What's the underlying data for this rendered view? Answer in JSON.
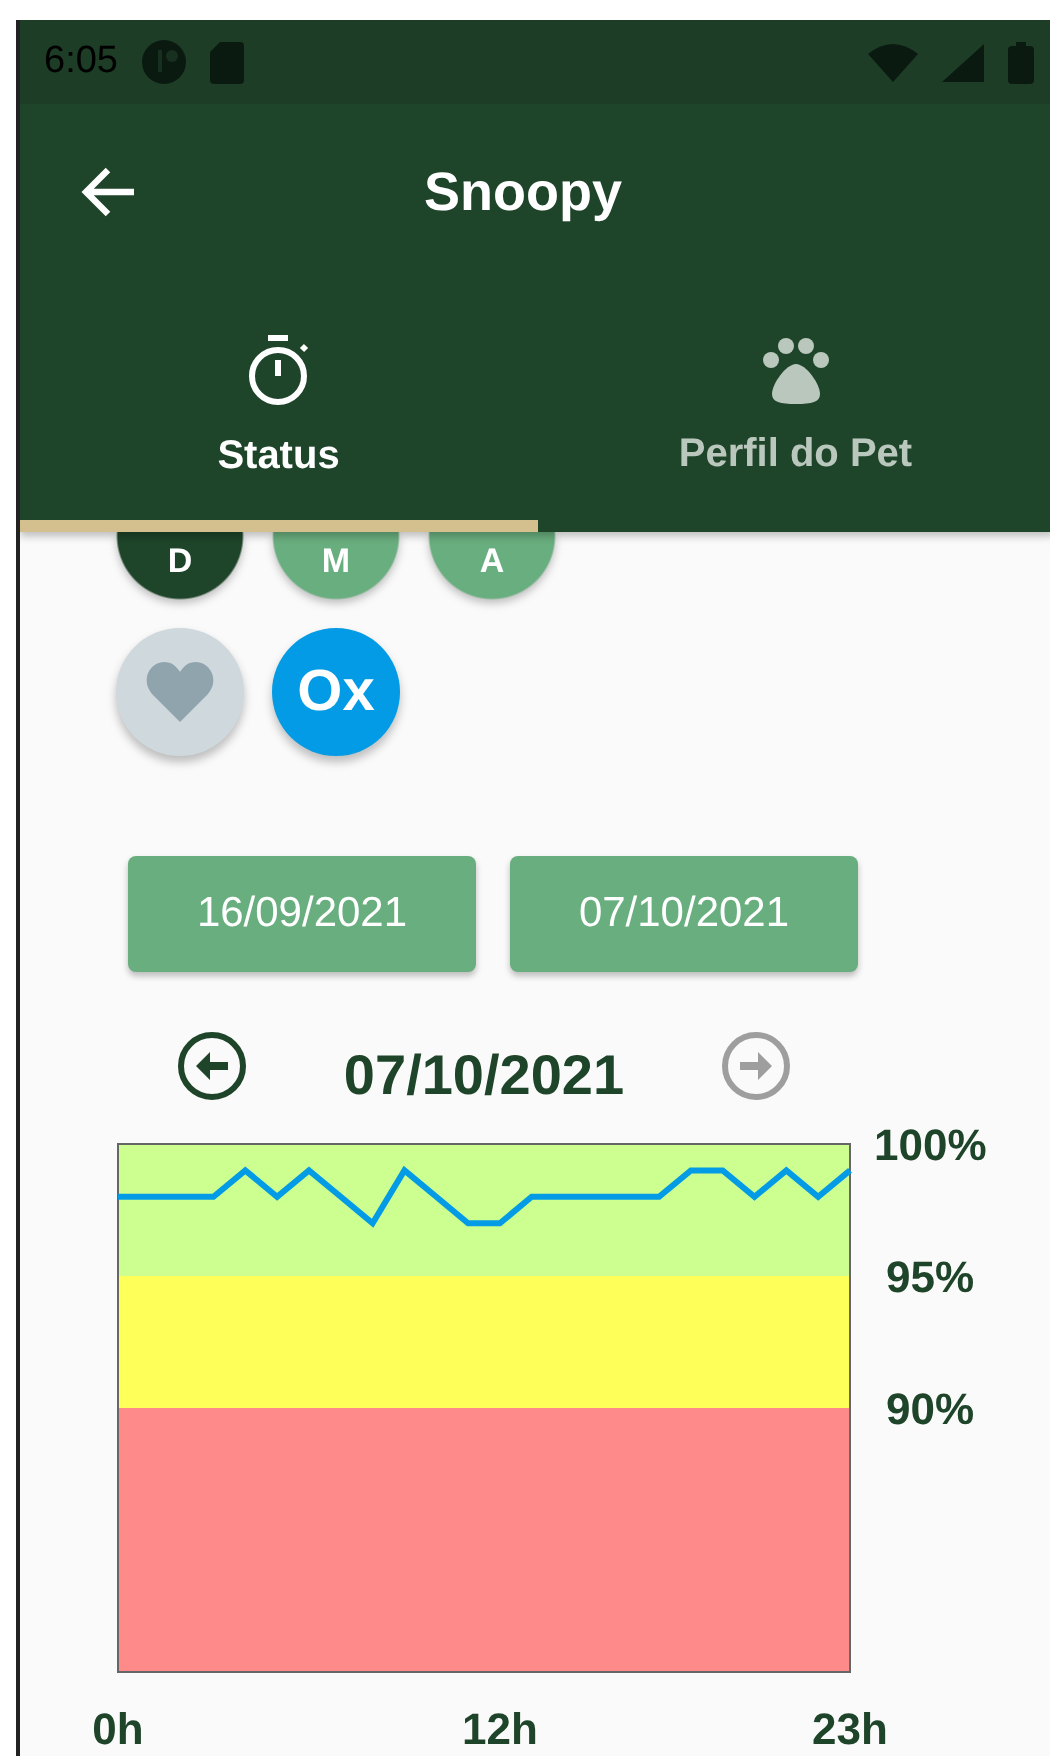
{
  "status_bar": {
    "time": "6:05"
  },
  "app_bar": {
    "title": "Snoopy"
  },
  "tabs": [
    {
      "label": "Status",
      "selected": true
    },
    {
      "label": "Perfil do Pet",
      "selected": false
    }
  ],
  "period_buttons": [
    {
      "label": "D",
      "selected": true
    },
    {
      "label": "M",
      "selected": false
    },
    {
      "label": "A",
      "selected": false
    }
  ],
  "metric_buttons": [
    {
      "kind": "heart",
      "selected": false
    },
    {
      "kind": "text",
      "label": "Ox",
      "selected": true
    }
  ],
  "date_range": [
    "16/09/2021",
    "07/10/2021"
  ],
  "day_nav": {
    "date": "07/10/2021",
    "prev_disabled": false,
    "next_disabled": true
  },
  "chart_data": {
    "type": "line",
    "xlim": [
      0,
      23
    ],
    "ylim": [
      80,
      100
    ],
    "yticks": [
      {
        "value": 100,
        "label": "100%"
      },
      {
        "value": 95,
        "label": "95%"
      },
      {
        "value": 90,
        "label": "90%"
      }
    ],
    "xticks": [
      {
        "value": 0,
        "label": "0h"
      },
      {
        "value": 12,
        "label": "12h"
      },
      {
        "value": 23,
        "label": "23h"
      }
    ],
    "x": [
      0,
      1,
      2,
      3,
      4,
      5,
      6,
      7,
      8,
      9,
      10,
      11,
      12,
      13,
      14,
      15,
      16,
      17,
      18,
      19,
      20,
      21,
      22,
      23
    ],
    "series": [
      {
        "color": "#039be5",
        "values": [
          98,
          98,
          98,
          98,
          99,
          98,
          99,
          98,
          97,
          99,
          98,
          97,
          97,
          98,
          98,
          98,
          98,
          98,
          99,
          99,
          98,
          99,
          98,
          99
        ]
      }
    ]
  }
}
